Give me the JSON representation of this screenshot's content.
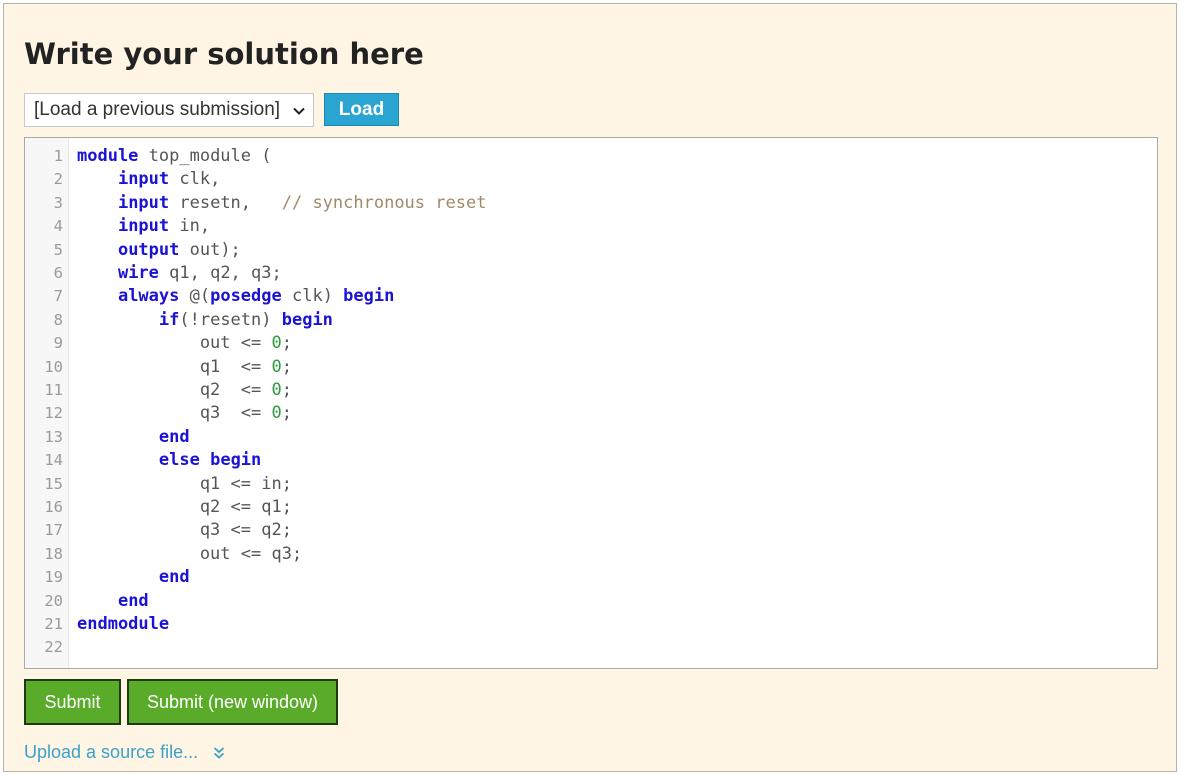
{
  "heading": "Write your solution here",
  "submission_select": {
    "selected": "[Load a previous submission]"
  },
  "load_button": "Load",
  "editor": {
    "lines": [
      [
        [
          "kw",
          "module"
        ],
        [
          "txt",
          " top_module ("
        ]
      ],
      [
        [
          "txt",
          "    "
        ],
        [
          "kw",
          "input"
        ],
        [
          "txt",
          " clk,"
        ]
      ],
      [
        [
          "txt",
          "    "
        ],
        [
          "kw",
          "input"
        ],
        [
          "txt",
          " resetn,   "
        ],
        [
          "com",
          "// synchronous reset"
        ]
      ],
      [
        [
          "txt",
          "    "
        ],
        [
          "kw",
          "input"
        ],
        [
          "txt",
          " in,"
        ]
      ],
      [
        [
          "txt",
          "    "
        ],
        [
          "kw",
          "output"
        ],
        [
          "txt",
          " out);"
        ]
      ],
      [
        [
          "txt",
          "    "
        ],
        [
          "kw",
          "wire"
        ],
        [
          "txt",
          " q1, q2, q3;"
        ]
      ],
      [
        [
          "txt",
          "    "
        ],
        [
          "kw",
          "always"
        ],
        [
          "txt",
          " @("
        ],
        [
          "kw",
          "posedge"
        ],
        [
          "txt",
          " clk) "
        ],
        [
          "kw",
          "begin"
        ]
      ],
      [
        [
          "txt",
          "        "
        ],
        [
          "kw",
          "if"
        ],
        [
          "txt",
          "(!resetn) "
        ],
        [
          "kw",
          "begin"
        ]
      ],
      [
        [
          "txt",
          "            out <= "
        ],
        [
          "num",
          "0"
        ],
        [
          "txt",
          ";"
        ]
      ],
      [
        [
          "txt",
          "            q1  <= "
        ],
        [
          "num",
          "0"
        ],
        [
          "txt",
          ";"
        ]
      ],
      [
        [
          "txt",
          "            q2  <= "
        ],
        [
          "num",
          "0"
        ],
        [
          "txt",
          ";"
        ]
      ],
      [
        [
          "txt",
          "            q3  <= "
        ],
        [
          "num",
          "0"
        ],
        [
          "txt",
          ";"
        ]
      ],
      [
        [
          "txt",
          "        "
        ],
        [
          "kw",
          "end"
        ]
      ],
      [
        [
          "txt",
          "        "
        ],
        [
          "kw",
          "else"
        ],
        [
          "txt",
          " "
        ],
        [
          "kw",
          "begin"
        ]
      ],
      [
        [
          "txt",
          "            q1 <= in;"
        ]
      ],
      [
        [
          "txt",
          "            q2 <= q1;"
        ]
      ],
      [
        [
          "txt",
          "            q3 <= q2;"
        ]
      ],
      [
        [
          "txt",
          "            out <= q3;"
        ]
      ],
      [
        [
          "txt",
          "        "
        ],
        [
          "kw",
          "end"
        ]
      ],
      [
        [
          "txt",
          "    "
        ],
        [
          "kw",
          "end"
        ]
      ],
      [
        [
          "kw",
          "endmodule"
        ]
      ],
      []
    ]
  },
  "buttons": {
    "submit": "Submit",
    "submit_new_window": "Submit (new window)"
  },
  "upload_link": "Upload a source file...",
  "icons": {
    "select_arrow": "chevron-down-icon",
    "upload_expand": "double-chevron-down-icon"
  },
  "colors": {
    "panel_bg": "#fef5e4",
    "keyword": "#1a12d4",
    "number": "#2e9a3e",
    "comment": "#a08a6a",
    "load_button": "#2aa4d0",
    "submit_button": "#5aab2a",
    "link": "#3aa0cc"
  }
}
